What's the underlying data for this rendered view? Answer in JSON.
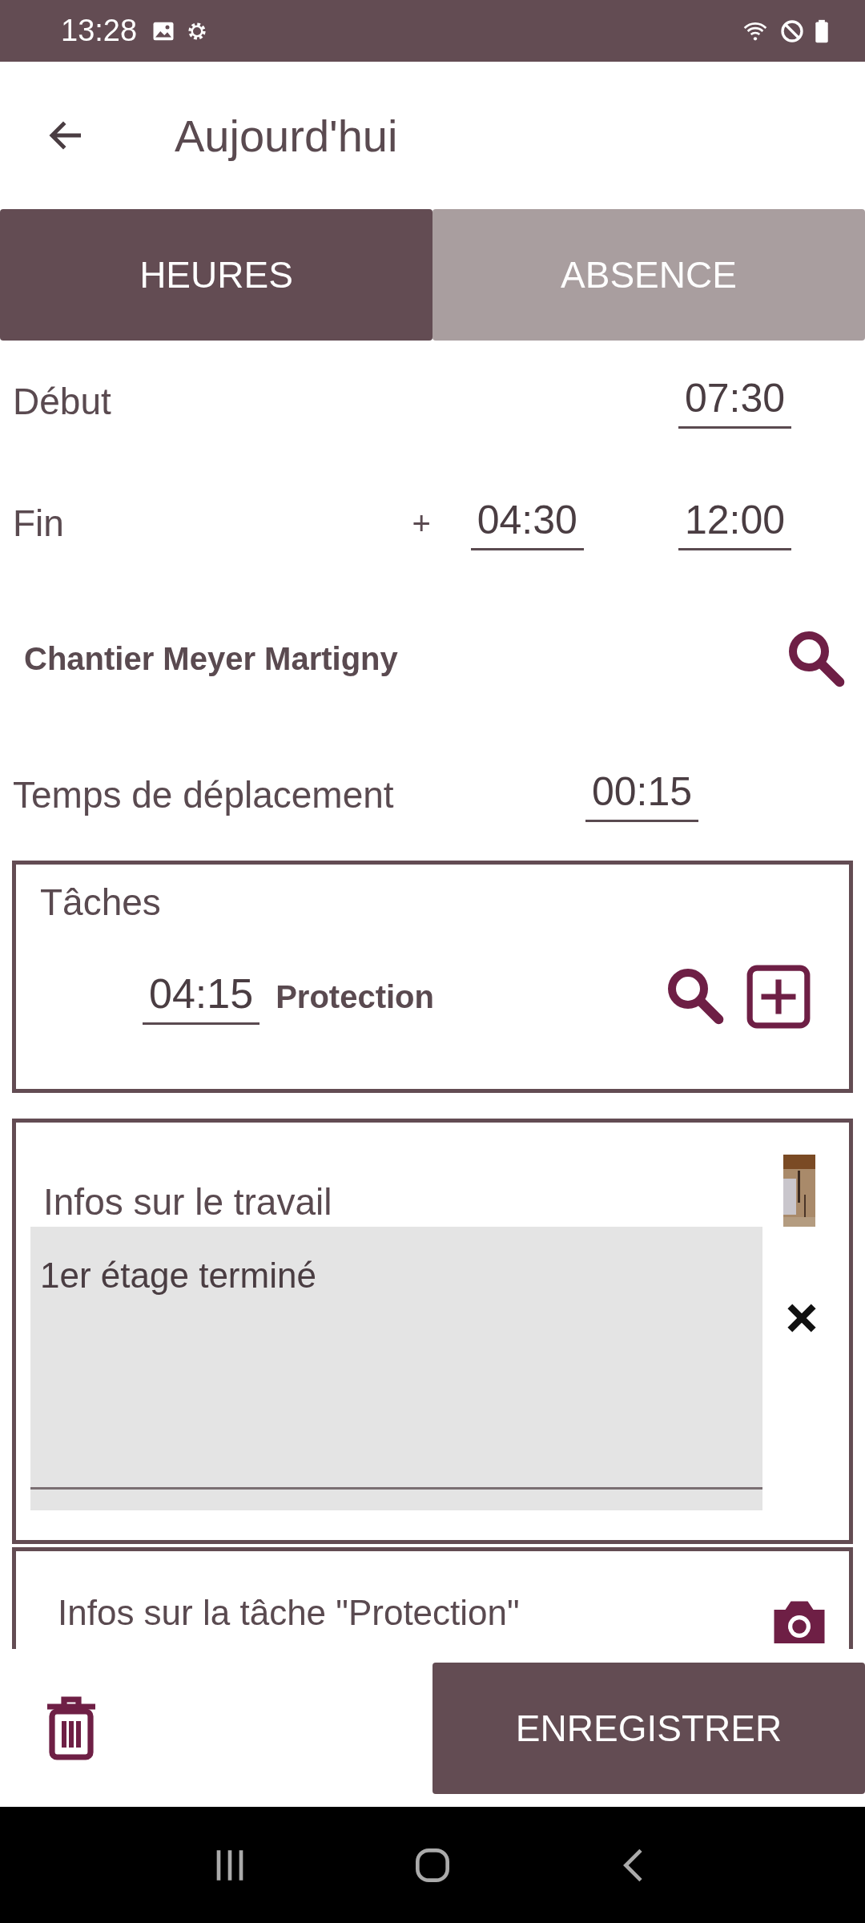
{
  "status_bar": {
    "time": "13:28"
  },
  "header": {
    "title": "Aujourd'hui"
  },
  "tabs": [
    {
      "label": "HEURES",
      "selected": true
    },
    {
      "label": "ABSENCE",
      "selected": false
    }
  ],
  "start": {
    "label": "Début",
    "value": "07:30"
  },
  "end": {
    "label": "Fin",
    "plus": "+",
    "duration": "04:30",
    "value": "12:00"
  },
  "site": {
    "name": "Chantier Meyer Martigny"
  },
  "travel": {
    "label": "Temps de déplacement",
    "value": "00:15"
  },
  "tasks": {
    "title": "Tâches",
    "items": [
      {
        "duration": "04:15",
        "name": "Protection"
      }
    ]
  },
  "work_info": {
    "title": "Infos sur le travail",
    "note": "1er étage terminé"
  },
  "task_info": {
    "title": "Infos sur la tâche \"Protection\""
  },
  "save_button": {
    "label": "ENREGISTRER"
  }
}
